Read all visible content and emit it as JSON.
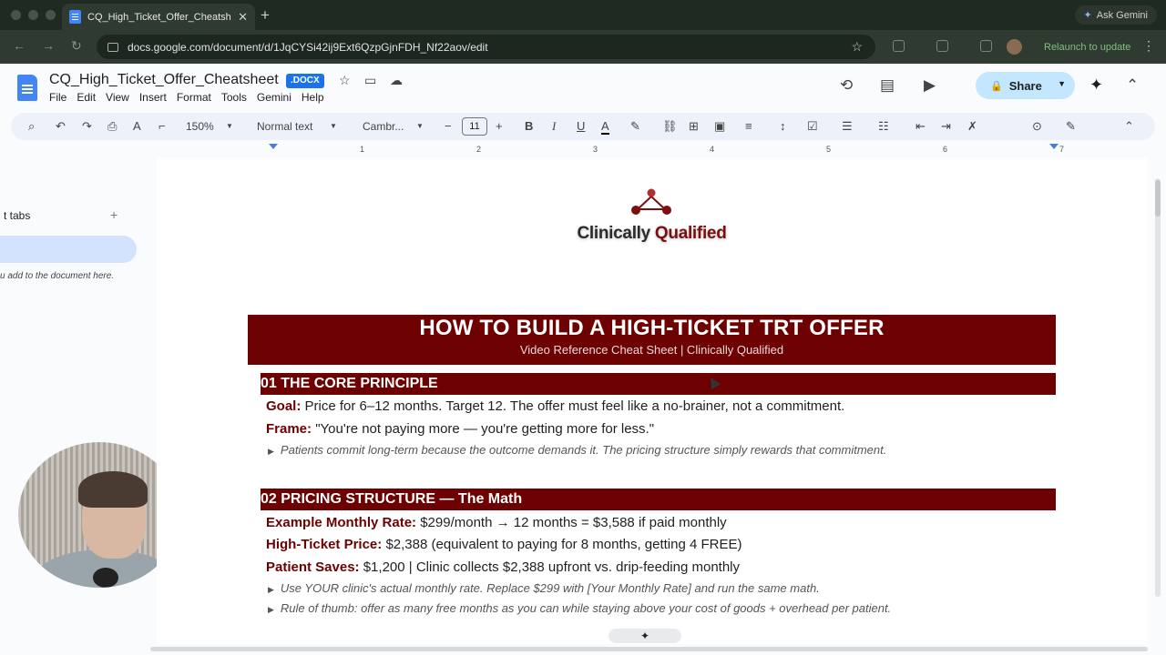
{
  "browser": {
    "tab_title": "CQ_High_Ticket_Offer_Cheatsheet",
    "tab_close": "✕",
    "new_tab": "+",
    "ask_gemini": "Ask Gemini",
    "url": "docs.google.com/document/d/1JqCYSi42ij9Ext6QzpGjnFDH_Nf22aov/edit",
    "relaunch": "Relaunch to update"
  },
  "docs": {
    "title": "CQ_High_Ticket_Offer_Cheatsheet",
    "badge": ".DOCX",
    "menu": [
      "File",
      "Edit",
      "View",
      "Insert",
      "Format",
      "Tools",
      "Gemini",
      "Help"
    ],
    "share_label": "Share"
  },
  "toolbar": {
    "zoom": "150%",
    "style": "Normal text",
    "font": "Cambr...",
    "font_size": "11"
  },
  "ruler": {
    "numbers": [
      "1",
      "2",
      "3",
      "4",
      "5",
      "6",
      "7"
    ]
  },
  "sidebar": {
    "tabs_label": "t tabs",
    "hint": "u add to the document here."
  },
  "document": {
    "logo": {
      "part1": "Clinically ",
      "part2": "Qualified"
    },
    "title": "HOW TO BUILD A HIGH-TICKET TRT OFFER",
    "subtitle": "Video Reference Cheat Sheet  |  Clinically Qualified",
    "section1": {
      "heading": "01  THE CORE PRINCIPLE",
      "goal_label": "Goal:",
      "goal_text": "Price for 6–12 months. Target 12. The offer must feel like a no-brainer, not a commitment.",
      "frame_label": "Frame:",
      "frame_text": "\"You're not paying more — you're getting more for less.\"",
      "note": "Patients commit long-term because the outcome demands it. The pricing structure simply rewards that commitment."
    },
    "section2": {
      "heading": "02  PRICING STRUCTURE — The Math",
      "rate_label": "Example Monthly Rate:",
      "rate_text": "$299/month  →  12 months = $3,588 if paid monthly",
      "price_label": "High-Ticket Price:",
      "price_text": "$2,388  (equivalent to paying for 8 months, getting 4 FREE)",
      "saves_label": "Patient Saves:",
      "saves_text": "$1,200  |  Clinic collects $2,388 upfront vs. drip-feeding monthly",
      "note1": "Use YOUR clinic's actual monthly rate. Replace $299 with [Your Monthly Rate] and run the same math.",
      "note2": "Rule of thumb: offer as many free months as you can while staying above your cost of goods + overhead per patient."
    }
  },
  "colors": {
    "accent": "#6d0000",
    "share_bg": "#c2e7ff",
    "tab_bg": "#1f2a20"
  }
}
